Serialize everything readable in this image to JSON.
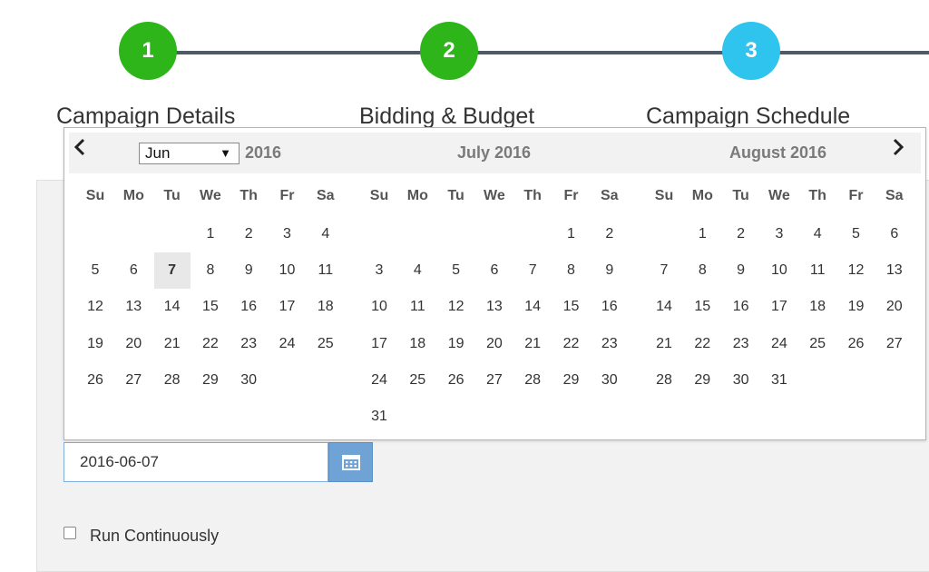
{
  "stepper": {
    "steps": [
      {
        "number": "1",
        "label": "Campaign Details",
        "status_color": "#2db51a"
      },
      {
        "number": "2",
        "label": "Bidding & Budget",
        "status_color": "#2db51a"
      },
      {
        "number": "3",
        "label": "Campaign Schedule",
        "status_color": "#2fc4ee"
      }
    ]
  },
  "datepicker": {
    "prev_icon": "chevron-left-icon",
    "next_icon": "chevron-right-icon",
    "month_select_value": "Jun",
    "year_label": "2016",
    "weekdays": [
      "Su",
      "Mo",
      "Tu",
      "We",
      "Th",
      "Fr",
      "Sa"
    ],
    "months": [
      {
        "title": "",
        "selected_day": 7,
        "weeks": [
          [
            "",
            "",
            "",
            "1",
            "2",
            "3",
            "4"
          ],
          [
            "5",
            "6",
            "7",
            "8",
            "9",
            "10",
            "11"
          ],
          [
            "12",
            "13",
            "14",
            "15",
            "16",
            "17",
            "18"
          ],
          [
            "19",
            "20",
            "21",
            "22",
            "23",
            "24",
            "25"
          ],
          [
            "26",
            "27",
            "28",
            "29",
            "30",
            "",
            ""
          ]
        ]
      },
      {
        "title": "July 2016",
        "selected_day": null,
        "weeks": [
          [
            "",
            "",
            "",
            "",
            "",
            "1",
            "2"
          ],
          [
            "3",
            "4",
            "5",
            "6",
            "7",
            "8",
            "9"
          ],
          [
            "10",
            "11",
            "12",
            "13",
            "14",
            "15",
            "16"
          ],
          [
            "17",
            "18",
            "19",
            "20",
            "21",
            "22",
            "23"
          ],
          [
            "24",
            "25",
            "26",
            "27",
            "28",
            "29",
            "30"
          ],
          [
            "31",
            "",
            "",
            "",
            "",
            "",
            ""
          ]
        ]
      },
      {
        "title": "August 2016",
        "selected_day": null,
        "weeks": [
          [
            "",
            "1",
            "2",
            "3",
            "4",
            "5",
            "6"
          ],
          [
            "7",
            "8",
            "9",
            "10",
            "11",
            "12",
            "13"
          ],
          [
            "14",
            "15",
            "16",
            "17",
            "18",
            "19",
            "20"
          ],
          [
            "21",
            "22",
            "23",
            "24",
            "25",
            "26",
            "27"
          ],
          [
            "28",
            "29",
            "30",
            "31",
            "",
            "",
            ""
          ]
        ]
      }
    ]
  },
  "start_date": {
    "value": "2016-06-07",
    "button_icon": "calendar-icon"
  },
  "run_continuously": {
    "label": "Run Continuously",
    "checked": false
  },
  "colors": {
    "accent_blue": "#6fa3d6",
    "step_done": "#2db51a",
    "step_active": "#2fc4ee"
  }
}
